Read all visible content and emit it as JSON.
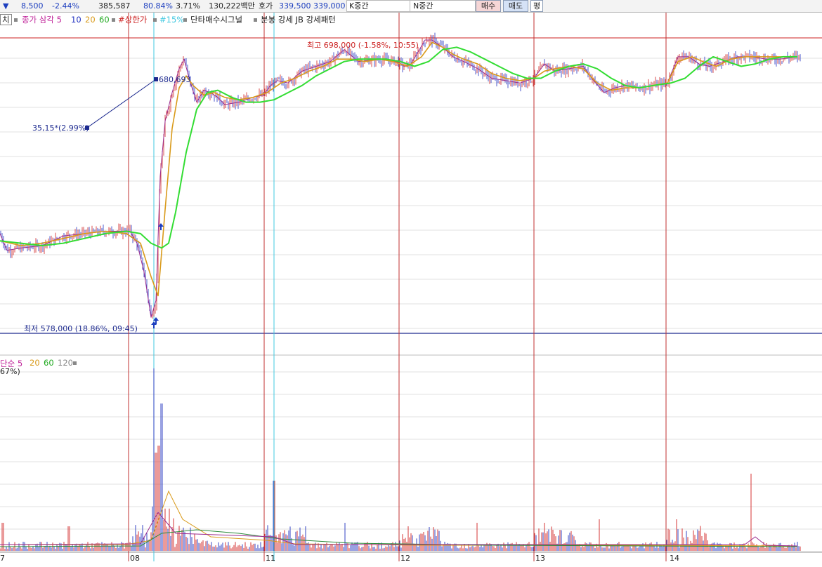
{
  "toolbar": {
    "arrow": "▼",
    "price": "8,500",
    "change_pct": "-2.44%",
    "volume": "385,587",
    "ratio": "80.84%",
    "rate": "3.71%",
    "amount": "130,222백만",
    "hoga_label": "호가",
    "ask": "339,500",
    "bid": "339,000",
    "k_label": "K중간",
    "n_label": "N중간",
    "buy_button": "매수",
    "sell_button": "매도",
    "even_button": "평"
  },
  "legend": {
    "prefix": "치",
    "ma_label": "종가 삼각 5",
    "ma10": "10",
    "ma20": "20",
    "ma60": "60",
    "limit_up": "#상한가",
    "pct15": "#15%",
    "signal": "단타매수시그널",
    "pattern": "분봉 강세 JB 강세패턴"
  },
  "annotations": {
    "high": "최고 698,000 (-1.58%, 10:55)",
    "low": "최저 578,000 (18.86%, 09:45)",
    "point_value": "680,693",
    "point_delta": "35,15*(2.99%)"
  },
  "volume_legend": {
    "prefix": "단순 5",
    "v20": "20",
    "v60": "60",
    "v120": "120",
    "pct": "67%)"
  },
  "dates": [
    "7",
    "08",
    "11",
    "12",
    "13",
    "14"
  ],
  "colors": {
    "ma5": "#9b2d8f",
    "ma20": "#d99a1a",
    "ma60": "#33dd33",
    "up": "#d02020",
    "down": "#2030c0",
    "divider": "#c03030",
    "cyan": "#40c8e0",
    "limit": "#cc2222"
  },
  "chart_data": {
    "type": "line",
    "title": "",
    "ylim": [
      574000,
      702000
    ],
    "high": 698000,
    "low": 578000,
    "days": [
      "7",
      "08",
      "11",
      "12",
      "13",
      "14"
    ],
    "series": [
      {
        "name": "종가",
        "points": [
          [
            0,
            616
          ],
          [
            10,
            609
          ],
          [
            30,
            610
          ],
          [
            60,
            611
          ],
          [
            90,
            615
          ],
          [
            120,
            616
          ],
          [
            150,
            617
          ],
          [
            175,
            617
          ],
          [
            185,
            617
          ],
          [
            195,
            612
          ],
          [
            205,
            600
          ],
          [
            215,
            581
          ],
          [
            222,
            588
          ],
          [
            228,
            640
          ],
          [
            235,
            663
          ],
          [
            245,
            675
          ],
          [
            255,
            685
          ],
          [
            262,
            689
          ],
          [
            270,
            680
          ],
          [
            280,
            671
          ],
          [
            290,
            676
          ],
          [
            300,
            675
          ],
          [
            310,
            673
          ],
          [
            320,
            670
          ],
          [
            340,
            671
          ],
          [
            360,
            673
          ],
          [
            375,
            674
          ],
          [
            385,
            678
          ],
          [
            395,
            680
          ],
          [
            410,
            679
          ],
          [
            430,
            684
          ],
          [
            450,
            686
          ],
          [
            470,
            688
          ],
          [
            490,
            693
          ],
          [
            510,
            688
          ],
          [
            540,
            689
          ],
          [
            565,
            688
          ],
          [
            575,
            686
          ],
          [
            585,
            687
          ],
          [
            595,
            692
          ],
          [
            605,
            697
          ],
          [
            615,
            697
          ],
          [
            630,
            694
          ],
          [
            645,
            690
          ],
          [
            660,
            688
          ],
          [
            680,
            685
          ],
          [
            700,
            681
          ],
          [
            720,
            680
          ],
          [
            740,
            679
          ],
          [
            760,
            681
          ],
          [
            775,
            687
          ],
          [
            790,
            684
          ],
          [
            810,
            685
          ],
          [
            830,
            686
          ],
          [
            845,
            680
          ],
          [
            860,
            675
          ],
          [
            875,
            677
          ],
          [
            890,
            678
          ],
          [
            910,
            677
          ],
          [
            930,
            678
          ],
          [
            950,
            679
          ],
          [
            965,
            690
          ],
          [
            980,
            690
          ],
          [
            995,
            687
          ],
          [
            1010,
            686
          ],
          [
            1030,
            688
          ],
          [
            1050,
            690
          ],
          [
            1070,
            690
          ],
          [
            1090,
            689
          ],
          [
            1110,
            689
          ],
          [
            1135,
            690
          ]
        ]
      },
      {
        "name": "20",
        "points": [
          [
            0,
            613
          ],
          [
            30,
            611
          ],
          [
            60,
            612
          ],
          [
            90,
            614
          ],
          [
            120,
            616
          ],
          [
            150,
            617
          ],
          [
            180,
            616
          ],
          [
            200,
            612
          ],
          [
            215,
            598
          ],
          [
            225,
            590
          ],
          [
            235,
            626
          ],
          [
            245,
            660
          ],
          [
            255,
            677
          ],
          [
            265,
            682
          ],
          [
            275,
            678
          ],
          [
            290,
            674
          ],
          [
            305,
            675
          ],
          [
            320,
            673
          ],
          [
            340,
            672
          ],
          [
            360,
            673
          ],
          [
            380,
            675
          ],
          [
            400,
            679
          ],
          [
            420,
            681
          ],
          [
            440,
            684
          ],
          [
            460,
            686
          ],
          [
            480,
            689
          ],
          [
            500,
            689
          ],
          [
            520,
            688
          ],
          [
            540,
            689
          ],
          [
            560,
            688
          ],
          [
            580,
            686
          ],
          [
            600,
            690
          ],
          [
            615,
            696
          ],
          [
            630,
            694
          ],
          [
            645,
            691
          ],
          [
            660,
            689
          ],
          [
            680,
            687
          ],
          [
            700,
            683
          ],
          [
            720,
            681
          ],
          [
            740,
            680
          ],
          [
            760,
            681
          ],
          [
            775,
            684
          ],
          [
            790,
            685
          ],
          [
            810,
            686
          ],
          [
            830,
            685
          ],
          [
            850,
            679
          ],
          [
            870,
            676
          ],
          [
            890,
            677
          ],
          [
            910,
            677
          ],
          [
            930,
            678
          ],
          [
            950,
            679
          ],
          [
            965,
            688
          ],
          [
            985,
            690
          ],
          [
            1000,
            688
          ],
          [
            1020,
            686
          ],
          [
            1040,
            689
          ],
          [
            1060,
            690
          ],
          [
            1080,
            690
          ],
          [
            1100,
            690
          ],
          [
            1120,
            690
          ],
          [
            1135,
            690
          ]
        ]
      },
      {
        "name": "60",
        "points": [
          [
            0,
            613
          ],
          [
            30,
            612
          ],
          [
            60,
            611
          ],
          [
            90,
            612
          ],
          [
            120,
            614
          ],
          [
            150,
            616
          ],
          [
            180,
            617
          ],
          [
            200,
            616
          ],
          [
            215,
            612
          ],
          [
            230,
            610
          ],
          [
            240,
            612
          ],
          [
            250,
            625
          ],
          [
            265,
            650
          ],
          [
            280,
            668
          ],
          [
            295,
            675
          ],
          [
            310,
            676
          ],
          [
            330,
            673
          ],
          [
            350,
            671
          ],
          [
            370,
            671
          ],
          [
            390,
            672
          ],
          [
            410,
            675
          ],
          [
            430,
            678
          ],
          [
            450,
            682
          ],
          [
            470,
            685
          ],
          [
            490,
            688
          ],
          [
            510,
            689
          ],
          [
            530,
            689
          ],
          [
            550,
            689
          ],
          [
            570,
            688
          ],
          [
            590,
            686
          ],
          [
            610,
            688
          ],
          [
            630,
            693
          ],
          [
            650,
            694
          ],
          [
            670,
            692
          ],
          [
            690,
            689
          ],
          [
            710,
            686
          ],
          [
            730,
            683
          ],
          [
            750,
            681
          ],
          [
            770,
            681
          ],
          [
            790,
            684
          ],
          [
            810,
            686
          ],
          [
            830,
            687
          ],
          [
            850,
            685
          ],
          [
            870,
            681
          ],
          [
            890,
            678
          ],
          [
            910,
            677
          ],
          [
            930,
            678
          ],
          [
            955,
            679
          ],
          [
            975,
            681
          ],
          [
            995,
            686
          ],
          [
            1015,
            690
          ],
          [
            1035,
            688
          ],
          [
            1055,
            686
          ],
          [
            1075,
            687
          ],
          [
            1095,
            689
          ],
          [
            1115,
            690
          ],
          [
            1135,
            690
          ]
        ]
      }
    ]
  }
}
